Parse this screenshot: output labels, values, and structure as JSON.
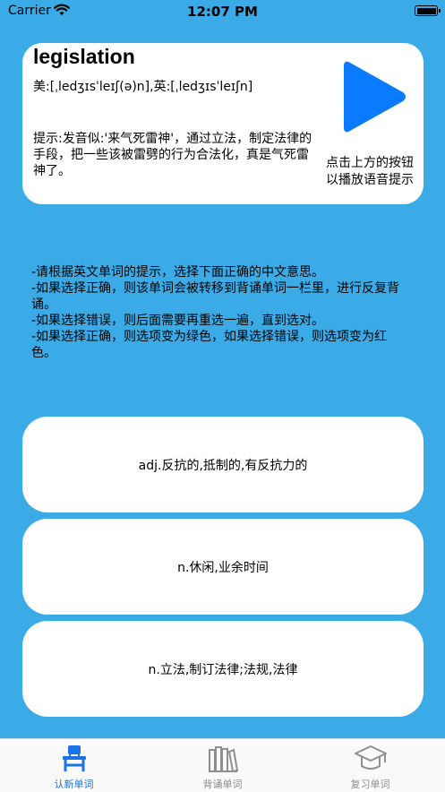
{
  "status_bar": {
    "carrier": "Carrier",
    "time": "12:07 PM"
  },
  "word_card": {
    "word": "legislation",
    "phonetic": "美:[ˌledʒɪsˈleɪʃ(ə)n],英:[ˌledʒɪsˈleɪʃn]",
    "hint": "提示:发音似:'来气死雷神'，通过立法，制定法律的手段，把一些该被雷劈的行为合法化，真是气死雷神了。",
    "play_caption": "点击上方的按钮以播放语音提示"
  },
  "instructions": [
    "-请根据英文单词的提示，选择下面正确的中文意思。",
    "-如果选择正确，则该单词会被转移到背诵单词一栏里，进行反复背诵。",
    "-如果选择错误，则后面需要再重选一遍，直到选对。",
    "-如果选择正确，则选项变为绿色，如果选择错误，则选项变为红色。"
  ],
  "options": [
    "adj.反抗的,抵制的,有反抗力的",
    "n.休闲,业余时间",
    "n.立法,制订法律;法规,法律"
  ],
  "tabs": [
    {
      "label": "认新单词",
      "icon": "desk-icon",
      "active": true
    },
    {
      "label": "背诵单词",
      "icon": "books-icon",
      "active": false
    },
    {
      "label": "复习单词",
      "icon": "graduation-cap-icon",
      "active": false
    }
  ],
  "colors": {
    "background": "#3aabe6",
    "accent": "#1a73e8",
    "play": "#0a7aff"
  }
}
